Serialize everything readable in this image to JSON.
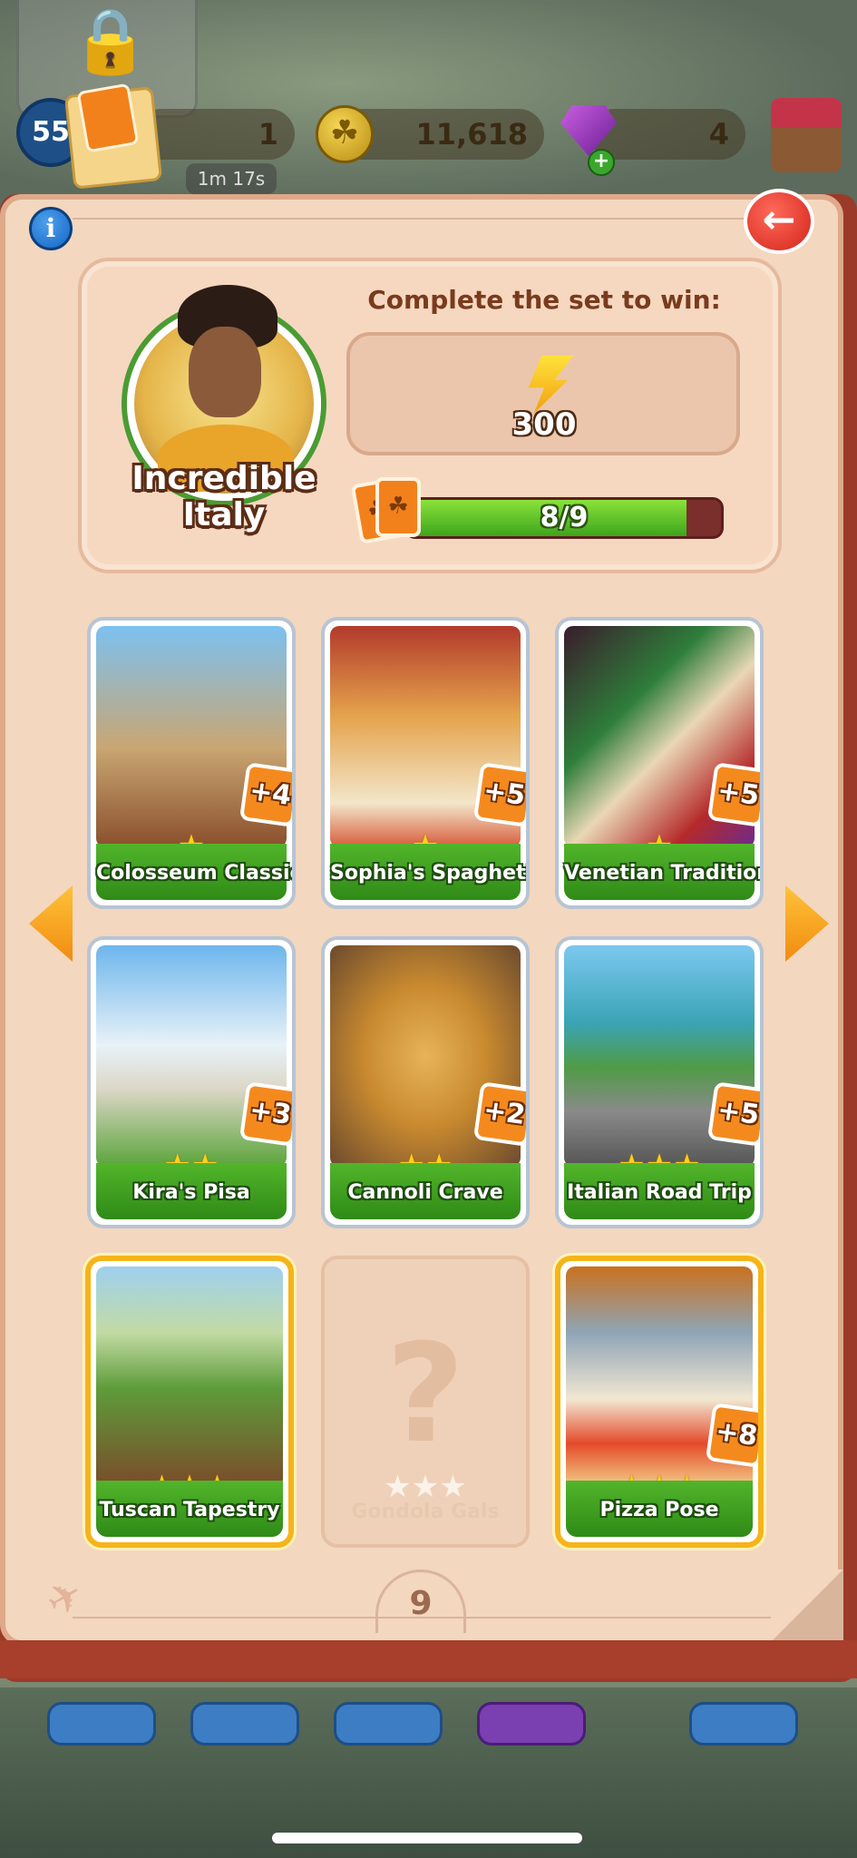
{
  "hud": {
    "level": "55",
    "pack_count": "1",
    "pack_timer": "1m 17s",
    "coins": "11,618",
    "gems": "4",
    "gem_plus": "+"
  },
  "book": {
    "info_label": "i",
    "back_label": "←",
    "set": {
      "name": "Incredible Italy",
      "reward_label": "Complete the set to win:",
      "reward_value": "300",
      "reward_icon": "lightning-bolt-icon",
      "progress_text": "8/9",
      "progress_fraction": 0.8889
    },
    "cards": [
      {
        "name": "Colosseum Classic",
        "stars": "★",
        "dupe": "+4",
        "state": "collected"
      },
      {
        "name": "Sophia's Spaghetti",
        "stars": "★",
        "dupe": "+5",
        "state": "collected"
      },
      {
        "name": "Venetian Tradition",
        "stars": "★",
        "dupe": "+5",
        "state": "collected"
      },
      {
        "name": "Kira's Pisa",
        "stars": "★★",
        "dupe": "+3",
        "state": "collected"
      },
      {
        "name": "Cannoli Crave",
        "stars": "★★",
        "dupe": "+2",
        "state": "collected"
      },
      {
        "name": "Italian Road Trip",
        "stars": "★★★",
        "dupe": "+5",
        "state": "collected"
      },
      {
        "name": "Tuscan Tapestry",
        "stars": "★★★",
        "dupe": "",
        "state": "gold"
      },
      {
        "name": "Gondola Gals",
        "stars": "★★★",
        "dupe": "",
        "state": "locked",
        "placeholder": "?"
      },
      {
        "name": "Pizza Pose",
        "stars": "★★★",
        "dupe": "+8",
        "state": "gold"
      }
    ],
    "page_number": "9"
  },
  "colors": {
    "card_label_green": "#3e9c1f",
    "dupe_orange": "#f48a1e",
    "gold_border": "#f6b419",
    "progress_green": "#5bc524",
    "book_page": "#f3d7bf",
    "back_red": "#d3241a",
    "info_blue": "#1466c3"
  }
}
